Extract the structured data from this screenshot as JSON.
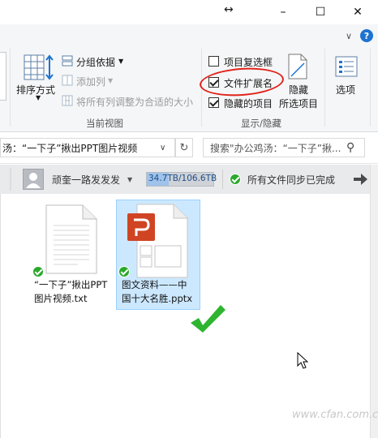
{
  "titlebar": {
    "drag_glyph": "↔",
    "minimize": "–",
    "maximize": "☐",
    "close": "✕",
    "help": "?",
    "expand": "∨"
  },
  "ribbon": {
    "sort_label": "排序方式",
    "group_by_label": "分组依据",
    "add_column_label": "添加列",
    "fit_columns_label": "将所有列调整为合适的大小",
    "current_view_label": "当前视图",
    "item_checkbox_label": "项目复选框",
    "item_checkbox_checked": false,
    "file_ext_label": "文件扩展名",
    "file_ext_checked": true,
    "hidden_items_label": "隐藏的项目",
    "hidden_items_checked": true,
    "hide_label": "隐藏",
    "selected_items_label": "所选项目",
    "show_hide_label": "显示/隐藏",
    "options_label": "选项",
    "highlight_color": "#e0231b"
  },
  "address": {
    "path": "汤：“一下子”揪出PPT图片视频",
    "dropdown_glyph": "∨",
    "refresh_glyph": "↻",
    "search_placeholder": "搜索\"办公鸡汤：“一下子”揪...",
    "search_glyph": "⚲"
  },
  "syncbar": {
    "user_name": "顽奎一路发发发",
    "storage_text": "34.7TB/106.6TB",
    "storage_fraction": 0.326,
    "sync_status": "所有文件同步已完成",
    "ok_color": "#2aa92a"
  },
  "files": [
    {
      "name_line1": "“一下子”揪出PPT",
      "name_line2": "图片视频.txt",
      "selected": false,
      "synced": true
    },
    {
      "name_line1": "图文资料——中",
      "name_line2": "国十大名胜.pptx",
      "selected": true,
      "synced": true
    }
  ],
  "ppt_logo_letter": "P",
  "accent_select": "#cce8ff",
  "accent_select_border": "#99d1ff",
  "watermark": "www.cfan.com.cn"
}
